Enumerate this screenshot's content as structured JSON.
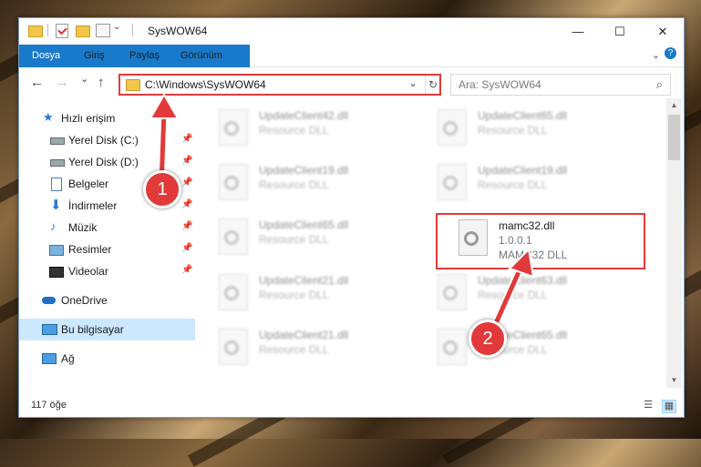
{
  "window": {
    "title": "SysWOW64",
    "controls": {
      "minimize": "—",
      "maximize": "☐",
      "close": "✕"
    }
  },
  "ribbon": {
    "tabs": [
      "Dosya",
      "Giriş",
      "Paylaş",
      "Görünüm"
    ],
    "expand": "⌄",
    "help": "?"
  },
  "nav": {
    "back": "←",
    "forward": "→",
    "recent": "⌄",
    "up": "↑"
  },
  "address": {
    "path": "C:\\Windows\\SysWOW64",
    "dropdown": "⌄",
    "refresh": "↻"
  },
  "search": {
    "placeholder": "Ara: SysWOW64",
    "icon": "⌕"
  },
  "sidebar": {
    "items": [
      {
        "label": "Hızlı erişim",
        "icon": "star-icon"
      },
      {
        "label": "Yerel Disk (C:)",
        "icon": "drive-icon",
        "pinned": true
      },
      {
        "label": "Yerel Disk (D:)",
        "icon": "drive-icon",
        "pinned": true
      },
      {
        "label": "Belgeler",
        "icon": "documents-icon",
        "pinned": true
      },
      {
        "label": "İndirmeler",
        "icon": "download-icon",
        "pinned": true
      },
      {
        "label": "Müzik",
        "icon": "music-icon",
        "pinned": true
      },
      {
        "label": "Resimler",
        "icon": "pictures-icon",
        "pinned": true
      },
      {
        "label": "Videolar",
        "icon": "videos-icon",
        "pinned": true
      },
      {
        "label": "OneDrive",
        "icon": "cloud-icon"
      },
      {
        "label": "Bu bilgisayar",
        "icon": "computer-icon",
        "selected": true
      },
      {
        "label": "Ağ",
        "icon": "network-icon"
      }
    ],
    "pin_glyph": "📌"
  },
  "files": [
    {
      "name": "UpdateClient42.dll",
      "type": "Resource DLL"
    },
    {
      "name": "UpdateClient65.dll",
      "type": "Resource DLL"
    },
    {
      "name": "UpdateClient19.dll",
      "type": "Resource DLL"
    },
    {
      "name": "UpdateClient19.dll",
      "type": "Resource DLL"
    },
    {
      "name": "UpdateClient65.dll",
      "type": "Resource DLL"
    },
    {
      "name": "mamc32.dll",
      "version": "1.0.0.1",
      "type": "MAMC32 DLL",
      "highlighted": true
    },
    {
      "name": "UpdateClient21.dll",
      "type": "Resource DLL"
    },
    {
      "name": "UpdateClient63.dll",
      "type": "Resource DLL"
    },
    {
      "name": "UpdateClient21.dll",
      "type": "Resource DLL"
    },
    {
      "name": "UpdateClient65.dll",
      "type": "Resource DLL"
    }
  ],
  "status": {
    "count": "117 öğe"
  },
  "callouts": [
    "1",
    "2"
  ],
  "colors": {
    "accent": "#1979ca",
    "highlight": "#e23a3a",
    "selection": "#cce8ff"
  }
}
